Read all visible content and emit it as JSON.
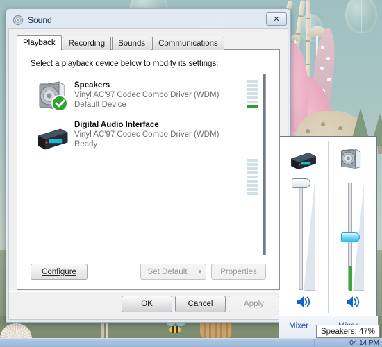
{
  "desktop": {
    "wallpaper_name": "pastel-nature-illustration",
    "sky_color": "#a8c5c4",
    "ground_color": "#8d9c86"
  },
  "taskbar": {
    "clock": "04:14 PM",
    "background_color": "#a9c0e0"
  },
  "sound_dialog": {
    "title": "Sound",
    "title_icon": "sound-speaker-icon",
    "close_label": "✕",
    "tabs": [
      {
        "label": "Playback",
        "active": true
      },
      {
        "label": "Recording",
        "active": false
      },
      {
        "label": "Sounds",
        "active": false
      },
      {
        "label": "Communications",
        "active": false
      }
    ],
    "instruction": "Select a playback device below to modify its settings:",
    "devices": [
      {
        "name": "Speakers",
        "driver": "Vinyl AC'97 Codec Combo Driver (WDM)",
        "status": "Default Device",
        "icon": "speaker-device-icon",
        "badge": "default-check-badge",
        "meter_segments": 9,
        "meter_lit_index": 6
      },
      {
        "name": "Digital Audio Interface",
        "driver": "Vinyl AC'97 Codec Combo Driver (WDM)",
        "status": "Ready",
        "icon": "digital-audio-device-icon",
        "badge": null,
        "meter_segments": 9,
        "meter_lit_index": -1
      }
    ],
    "buttons": {
      "configure": "Configure",
      "set_default": "Set Default",
      "set_default_arrow": "▼",
      "properties": "Properties",
      "ok": "OK",
      "cancel": "Cancel",
      "apply": "Apply",
      "apply_disabled": true
    }
  },
  "volume_mixer": {
    "columns": [
      {
        "device": "digital-audio-device-icon",
        "slider_percent": 100,
        "slider_hot": false,
        "speaker_icon": "volume-speaker-icon",
        "mixer_link": "Mixer"
      },
      {
        "device": "speaker-device-icon",
        "slider_percent": 47,
        "slider_hot": true,
        "speaker_icon": "volume-speaker-icon",
        "mixer_link": "Mixer"
      }
    ],
    "tooltip": "Speakers: 47%",
    "accent_color": "#2a49a8",
    "fill_color": "#3aa83a",
    "thumb_hot_color": "#35bcec"
  }
}
